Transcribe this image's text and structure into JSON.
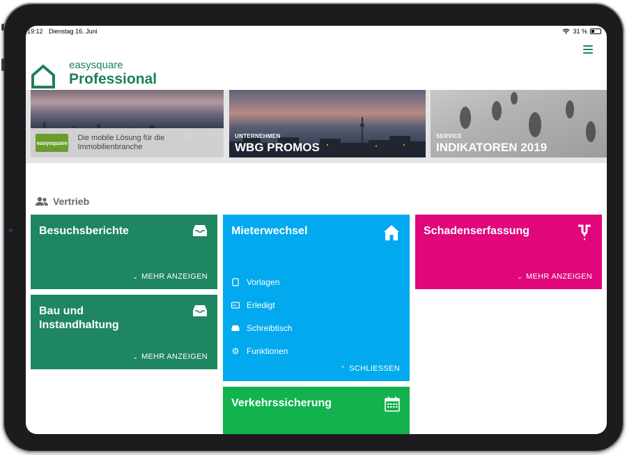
{
  "statusbar": {
    "time": "19:12",
    "date": "Dienstag 16. Juni",
    "battery": "31 %"
  },
  "header": {
    "logo_small": "easysquare",
    "logo_big": "Professional"
  },
  "banners": [
    {
      "badge": "easysquare",
      "caption": "Die mobile Lösung für die Immobilienbranche"
    },
    {
      "kicker": "UNTERNEHMEN",
      "title": "WBG PROMOS"
    },
    {
      "kicker": "SERVICE",
      "title": "INDIKATOREN 2019"
    }
  ],
  "section": {
    "title": "Vertrieb"
  },
  "tiles": {
    "besuchsberichte": {
      "title": "Besuchsberichte",
      "more": "MEHR ANZEIGEN",
      "icon": "inbox-icon"
    },
    "bau": {
      "title": "Bau und Instandhaltung",
      "more": "MEHR ANZEIGEN",
      "icon": "inbox-icon"
    },
    "mieterwechsel": {
      "title": "Mieterwechsel",
      "icon": "home-icon",
      "items": [
        "Vorlagen",
        "Erledigt",
        "Schreibtisch",
        "Funktionen"
      ],
      "close": "SCHLIESSEN"
    },
    "schaden": {
      "title": "Schadenserfassung",
      "more": "MEHR ANZEIGEN",
      "icon": "pipe-icon"
    },
    "verkehr": {
      "title": "Verkehrssicherung",
      "icon": "calendar-icon"
    }
  },
  "colors": {
    "green": "#1e8660",
    "blue": "#03a9ee",
    "magenta": "#e0077d",
    "lime": "#12b34d"
  }
}
